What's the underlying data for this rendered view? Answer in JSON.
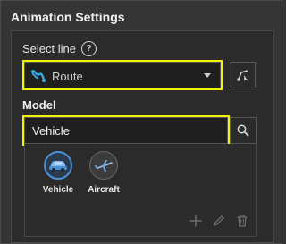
{
  "panel": {
    "title": "Animation Settings"
  },
  "select_line": {
    "label": "Select line",
    "value": "Route"
  },
  "model": {
    "label": "Model",
    "input_value": "Vehicle"
  },
  "gallery": {
    "items": [
      {
        "label": "Vehicle",
        "icon": "car-icon",
        "selected": true
      },
      {
        "label": "Aircraft",
        "icon": "aircraft-icon",
        "selected": false
      }
    ],
    "tools": [
      "add-icon",
      "edit-pencil-icon",
      "delete-trash-icon"
    ]
  },
  "colors": {
    "highlight": "#f2f200",
    "selection": "#4a90d9",
    "background": "#353535",
    "panel": "#2b2b2b"
  }
}
